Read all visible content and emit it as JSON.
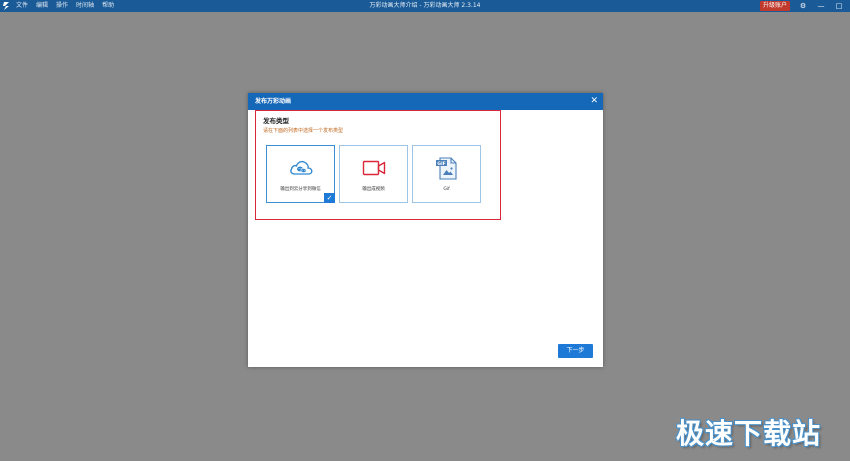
{
  "window": {
    "title": "万彩动画大师介绍 - 万彩动画大师 2.3.14",
    "menu": [
      "文件",
      "编辑",
      "操作",
      "时间轴",
      "帮助"
    ],
    "upgrade_label": "升级账户",
    "controls": [
      "⚙",
      "—",
      "□",
      "✕"
    ]
  },
  "dialog": {
    "title": "发布万彩动画",
    "close": "✕",
    "section_title": "发布类型",
    "section_hint": "请在下面的列表中选择一个发布类型",
    "cards": [
      {
        "label": "输出到云分享到微信",
        "icon": "cloud-wechat-icon",
        "selected": true
      },
      {
        "label": "输出成视频",
        "icon": "video-camera-icon",
        "selected": false
      },
      {
        "label": "Gif",
        "icon": "gif-file-icon",
        "selected": false
      }
    ],
    "check": "✓",
    "next_label": "下一步"
  },
  "watermark": "极速下载站",
  "colors": {
    "titlebar": "#1a5a96",
    "dialog_header": "#1568b8",
    "accent": "#1e7ad6",
    "highlight": "#d9283a",
    "upgrade": "#c0392b",
    "backdrop": "#8a8a8a"
  }
}
